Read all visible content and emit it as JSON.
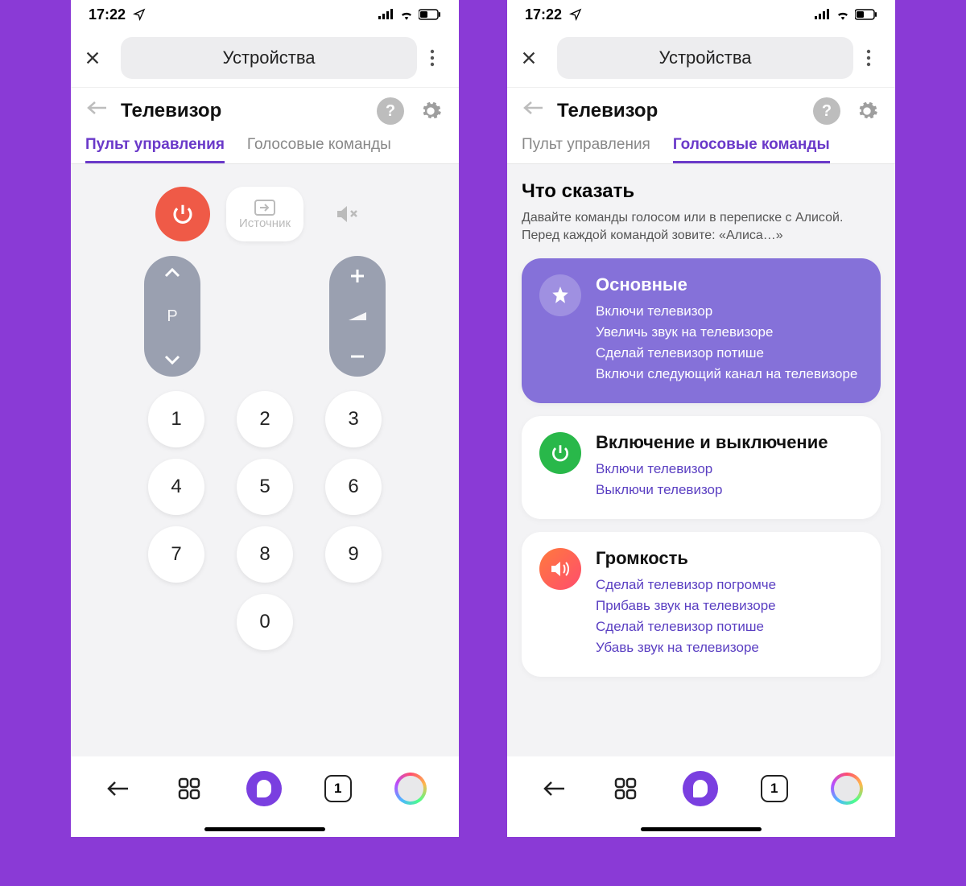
{
  "status": {
    "time": "17:22"
  },
  "header": {
    "pill": "Устройства"
  },
  "subheader": {
    "title": "Телевизор"
  },
  "tabs": {
    "remote": "Пульт управления",
    "voice": "Голосовые команды"
  },
  "remote": {
    "source_label": "Источник",
    "channel_letter": "P",
    "keys": [
      "1",
      "2",
      "3",
      "4",
      "5",
      "6",
      "7",
      "8",
      "9",
      "0"
    ]
  },
  "voice": {
    "heading": "Что сказать",
    "subtext": "Давайте команды голосом или в переписке с Алисой. Перед каждой командой зовите: «Алиса…»",
    "cards": [
      {
        "title": "Основные",
        "lines": [
          "Включи телевизор",
          "Увеличь звук на телевизоре",
          "Сделай телевизор потише",
          "Включи следующий канал на телевизоре"
        ]
      },
      {
        "title": "Включение и выключение",
        "lines": [
          "Включи телевизор",
          "Выключи телевизор"
        ]
      },
      {
        "title": "Громкость",
        "lines": [
          "Сделай телевизор погромче",
          "Прибавь звук на телевизоре",
          "Сделай телевизор потише",
          "Убавь звук на телевизоре"
        ]
      }
    ]
  },
  "bottombar": {
    "tab_count": "1"
  }
}
